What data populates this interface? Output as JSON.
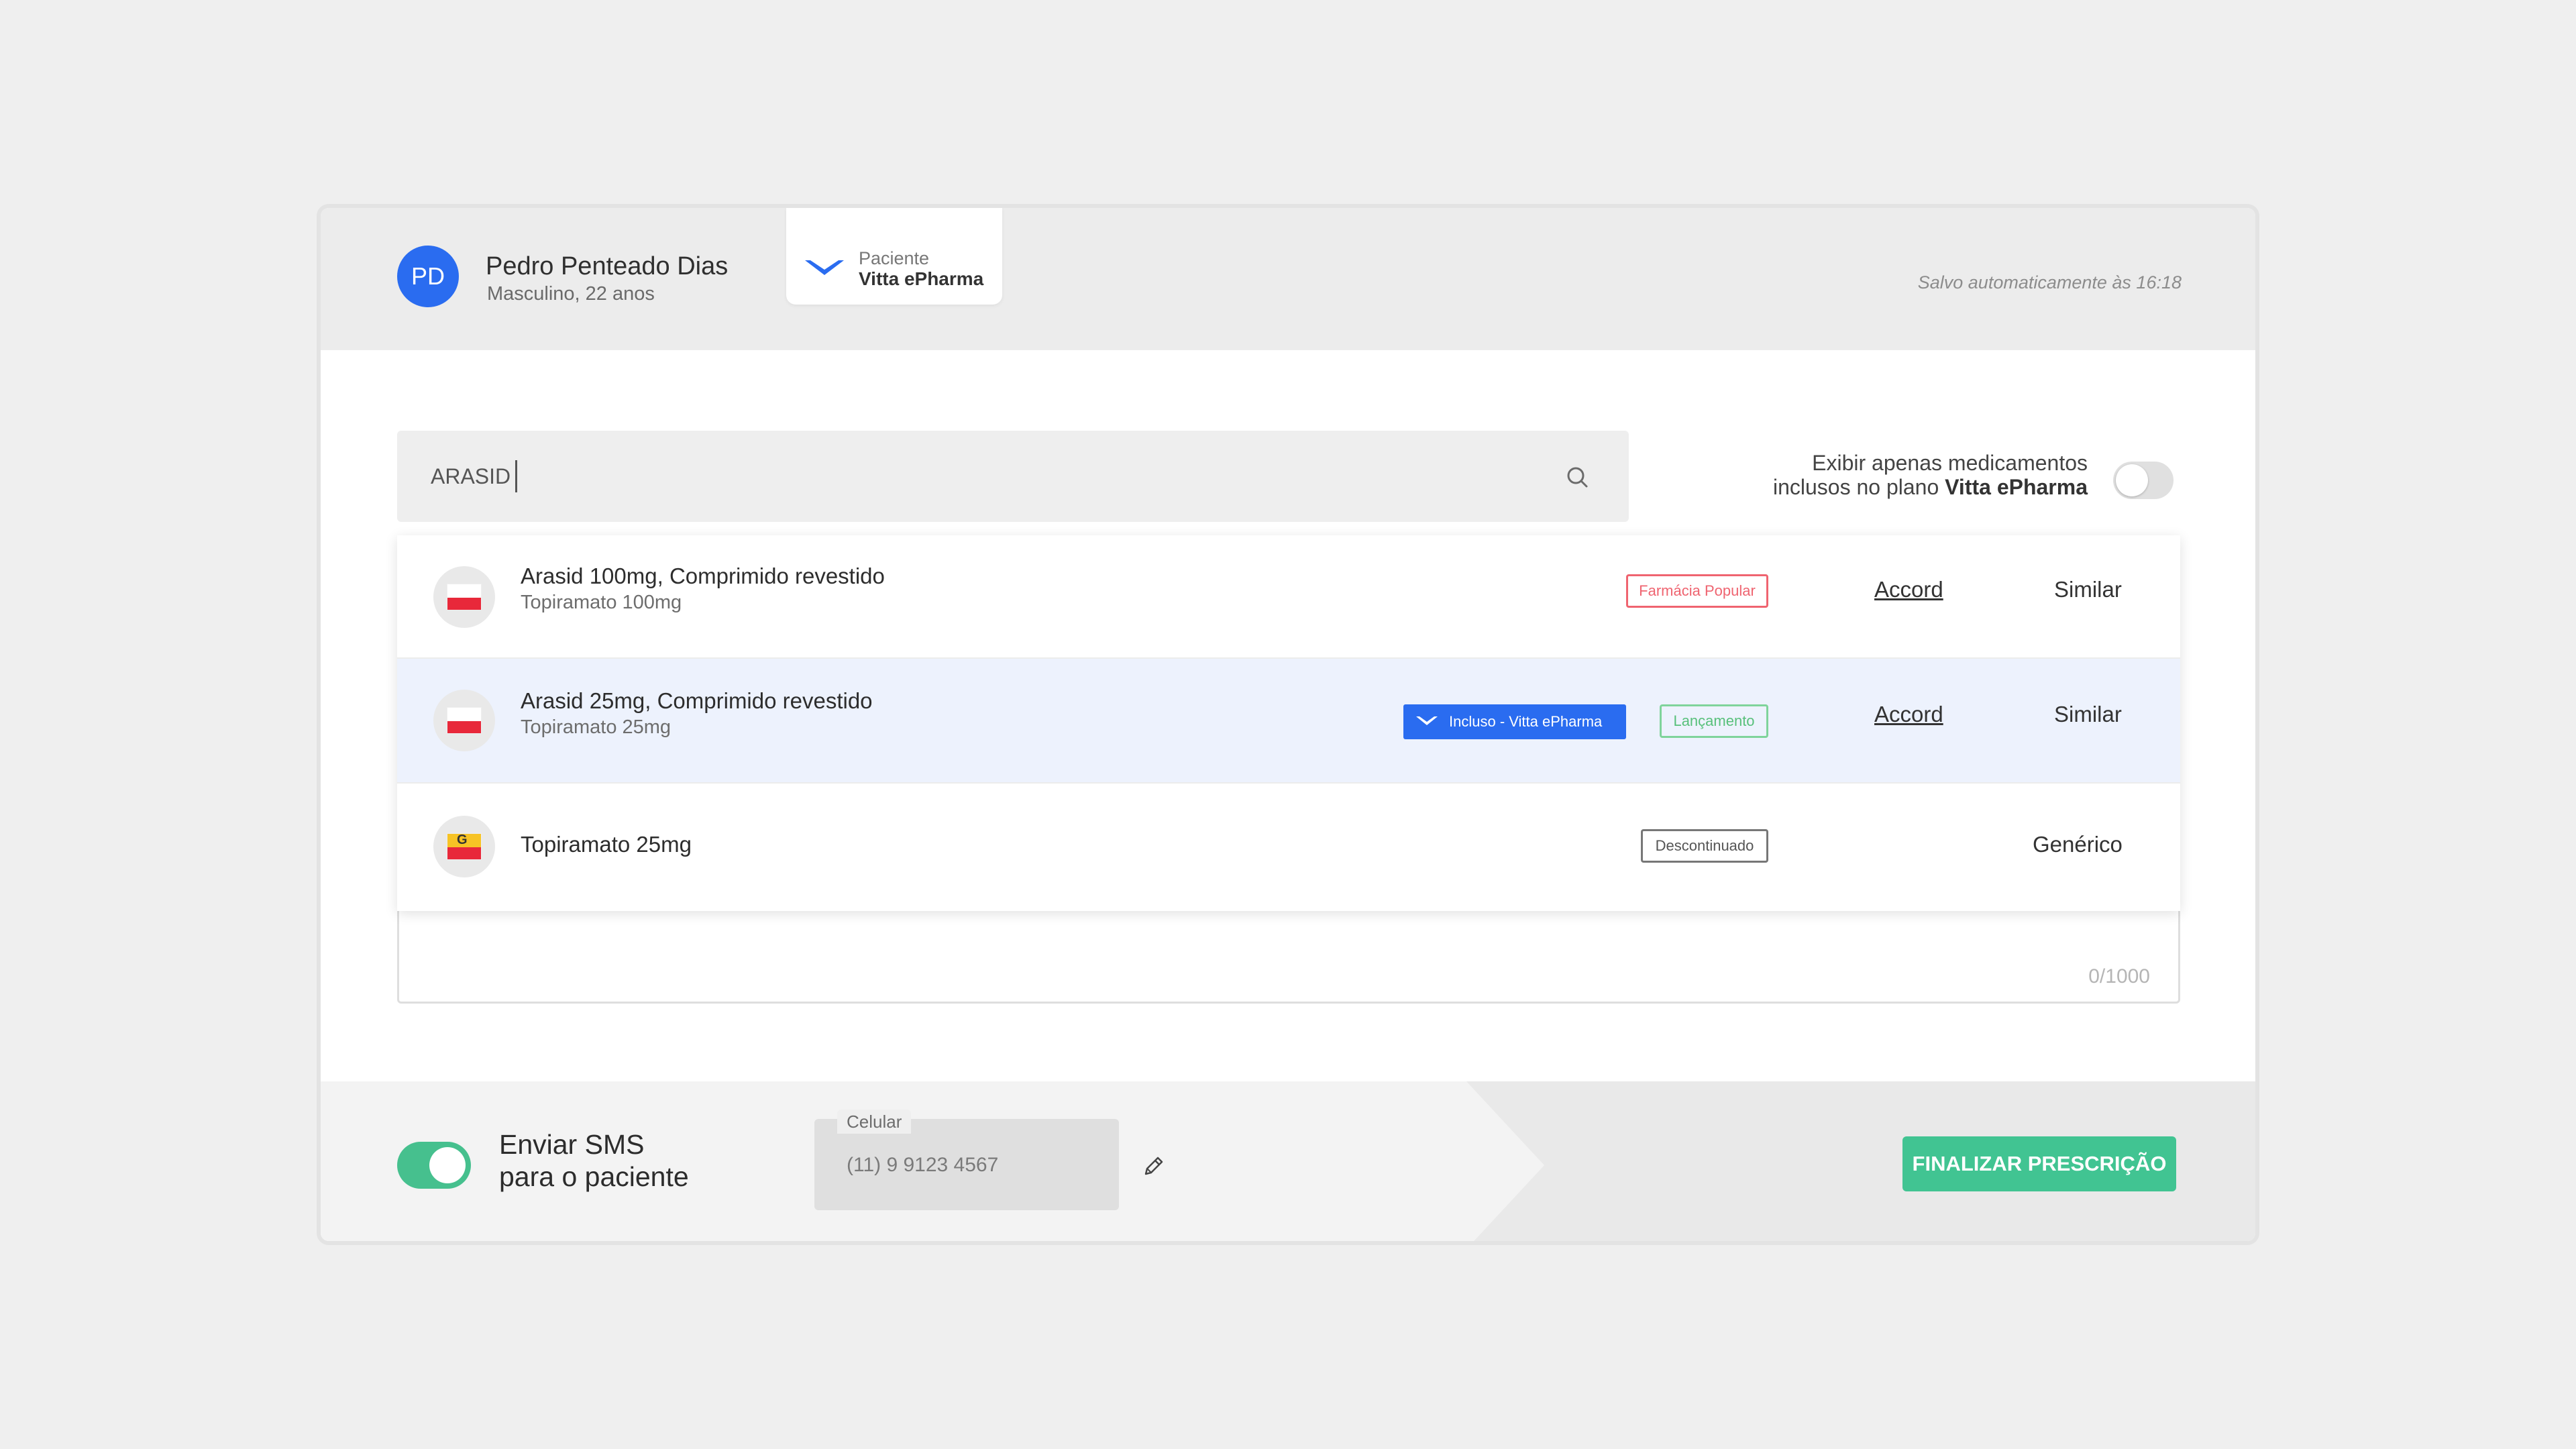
{
  "patient": {
    "initials": "PD",
    "name": "Pedro Penteado Dias",
    "info": "Masculino, 22 anos"
  },
  "plan": {
    "label": "Paciente",
    "name": "Vitta ePharma",
    "icon": "chevron-logo-icon",
    "color": "#2a6cf0"
  },
  "autosave": "Salvo automaticamente às 16:18",
  "search": {
    "value": "ARASID",
    "icon": "search-icon"
  },
  "filter": {
    "line1": "Exibir apenas medicamentos",
    "line2_prefix": "inclusos no plano",
    "line2_bold": "Vitta ePharma",
    "enabled": false
  },
  "results": [
    {
      "name": "Arasid 100mg, Comprimido revestido",
      "substance": "Topiramato 100mg",
      "tags": [
        "Farmácia Popular"
      ],
      "lab": "Accord",
      "type": "Similar"
    },
    {
      "name": "Arasid 25mg, Comprimido revestido",
      "substance": "Topiramato 25mg",
      "included_tag": "Incluso - Vitta ePharma",
      "tags": [
        "Lançamento"
      ],
      "lab": "Accord",
      "type": "Similar",
      "highlighted": true
    },
    {
      "name": "Topiramato 25mg",
      "substance": "",
      "generic_badge": "G",
      "tags": [
        "Descontinuado"
      ],
      "lab": "",
      "type": "Genérico"
    }
  ],
  "notes": {
    "counter": "0/1000"
  },
  "footer": {
    "sms_line1": "Enviar SMS",
    "sms_line2": "para o paciente",
    "sms_enabled": true,
    "phone_label": "Celular",
    "phone_value": "(11) 9 9123 4567",
    "finish_label": "FINALIZAR PRESCRIÇÃO",
    "accent": "#41c492"
  }
}
